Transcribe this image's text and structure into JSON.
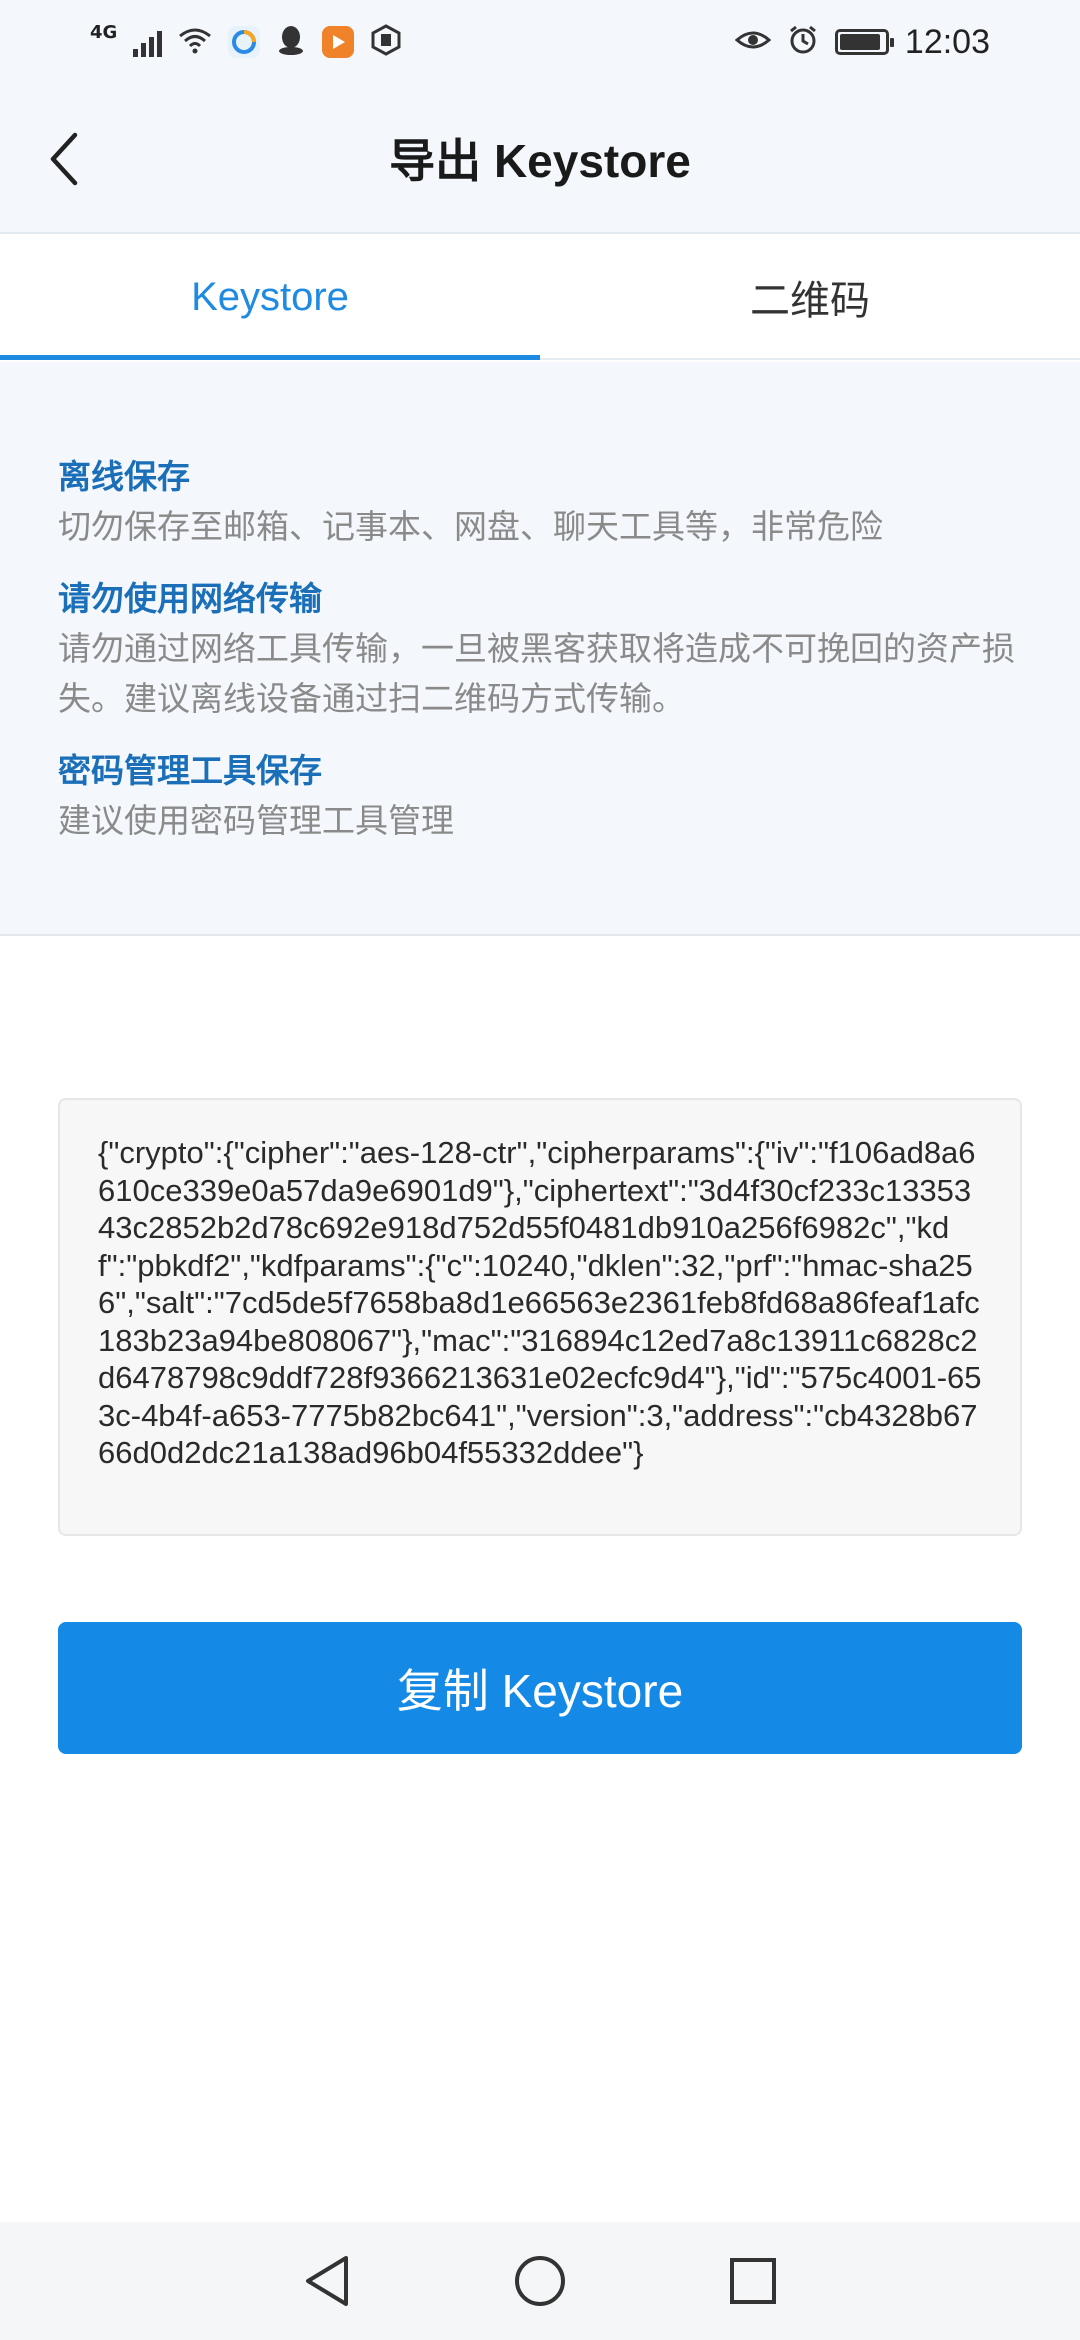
{
  "status_bar": {
    "network": "4G",
    "time": "12:03",
    "icons": [
      "signal-icon",
      "wifi-icon",
      "browser-app-icon",
      "qq-icon",
      "video-app-icon",
      "app-icon",
      "eye-care-icon",
      "alarm-icon",
      "battery-icon"
    ]
  },
  "header": {
    "title": "导出 Keystore",
    "back_icon": "chevron-left-icon"
  },
  "tabs": [
    {
      "label": "Keystore",
      "active": true
    },
    {
      "label": "二维码",
      "active": false
    }
  ],
  "notices": [
    {
      "title": "离线保存",
      "desc": "切勿保存至邮箱、记事本、网盘、聊天工具等，非常危险"
    },
    {
      "title": "请勿使用网络传输",
      "desc": "请勿通过网络工具传输，一旦被黑客获取将造成不可挽回的资产损失。建议离线设备通过扫二维码方式传输。"
    },
    {
      "title": "密码管理工具保存",
      "desc": "建议使用密码管理工具管理"
    }
  ],
  "keystore": {
    "text": "{\"crypto\":{\"cipher\":\"aes-128-ctr\",\"cipherparams\":{\"iv\":\"f106ad8a6610ce339e0a57da9e6901d9\"},\"ciphertext\":\"3d4f30cf233c1335343c2852b2d78c692e918d752d55f0481db910a256f6982c\",\"kdf\":\"pbkdf2\",\"kdfparams\":{\"c\":10240,\"dklen\":32,\"prf\":\"hmac-sha256\",\"salt\":\"7cd5de5f7658ba8d1e66563e2361feb8fd68a86feaf1afc183b23a94be808067\"},\"mac\":\"316894c12ed7a8c13911c6828c2d6478798c9ddf728f9366213631e02ecfc9d4\"},\"id\":\"575c4001-653c-4b4f-a653-7775b82bc641\",\"version\":3,\"address\":\"cb4328b6766d0d2dc21a138ad96b04f55332ddee\"}"
  },
  "copy_button": {
    "label": "复制 Keystore"
  },
  "colors": {
    "accent": "#1f8ae2",
    "button": "#1489e6",
    "notice_title": "#1a6fb8",
    "notice_desc": "#8a8a8a",
    "panel_bg": "#f4f8fc"
  },
  "nav": {
    "back_icon": "triangle-back-icon",
    "home_icon": "circle-home-icon",
    "recents_icon": "square-recents-icon"
  }
}
